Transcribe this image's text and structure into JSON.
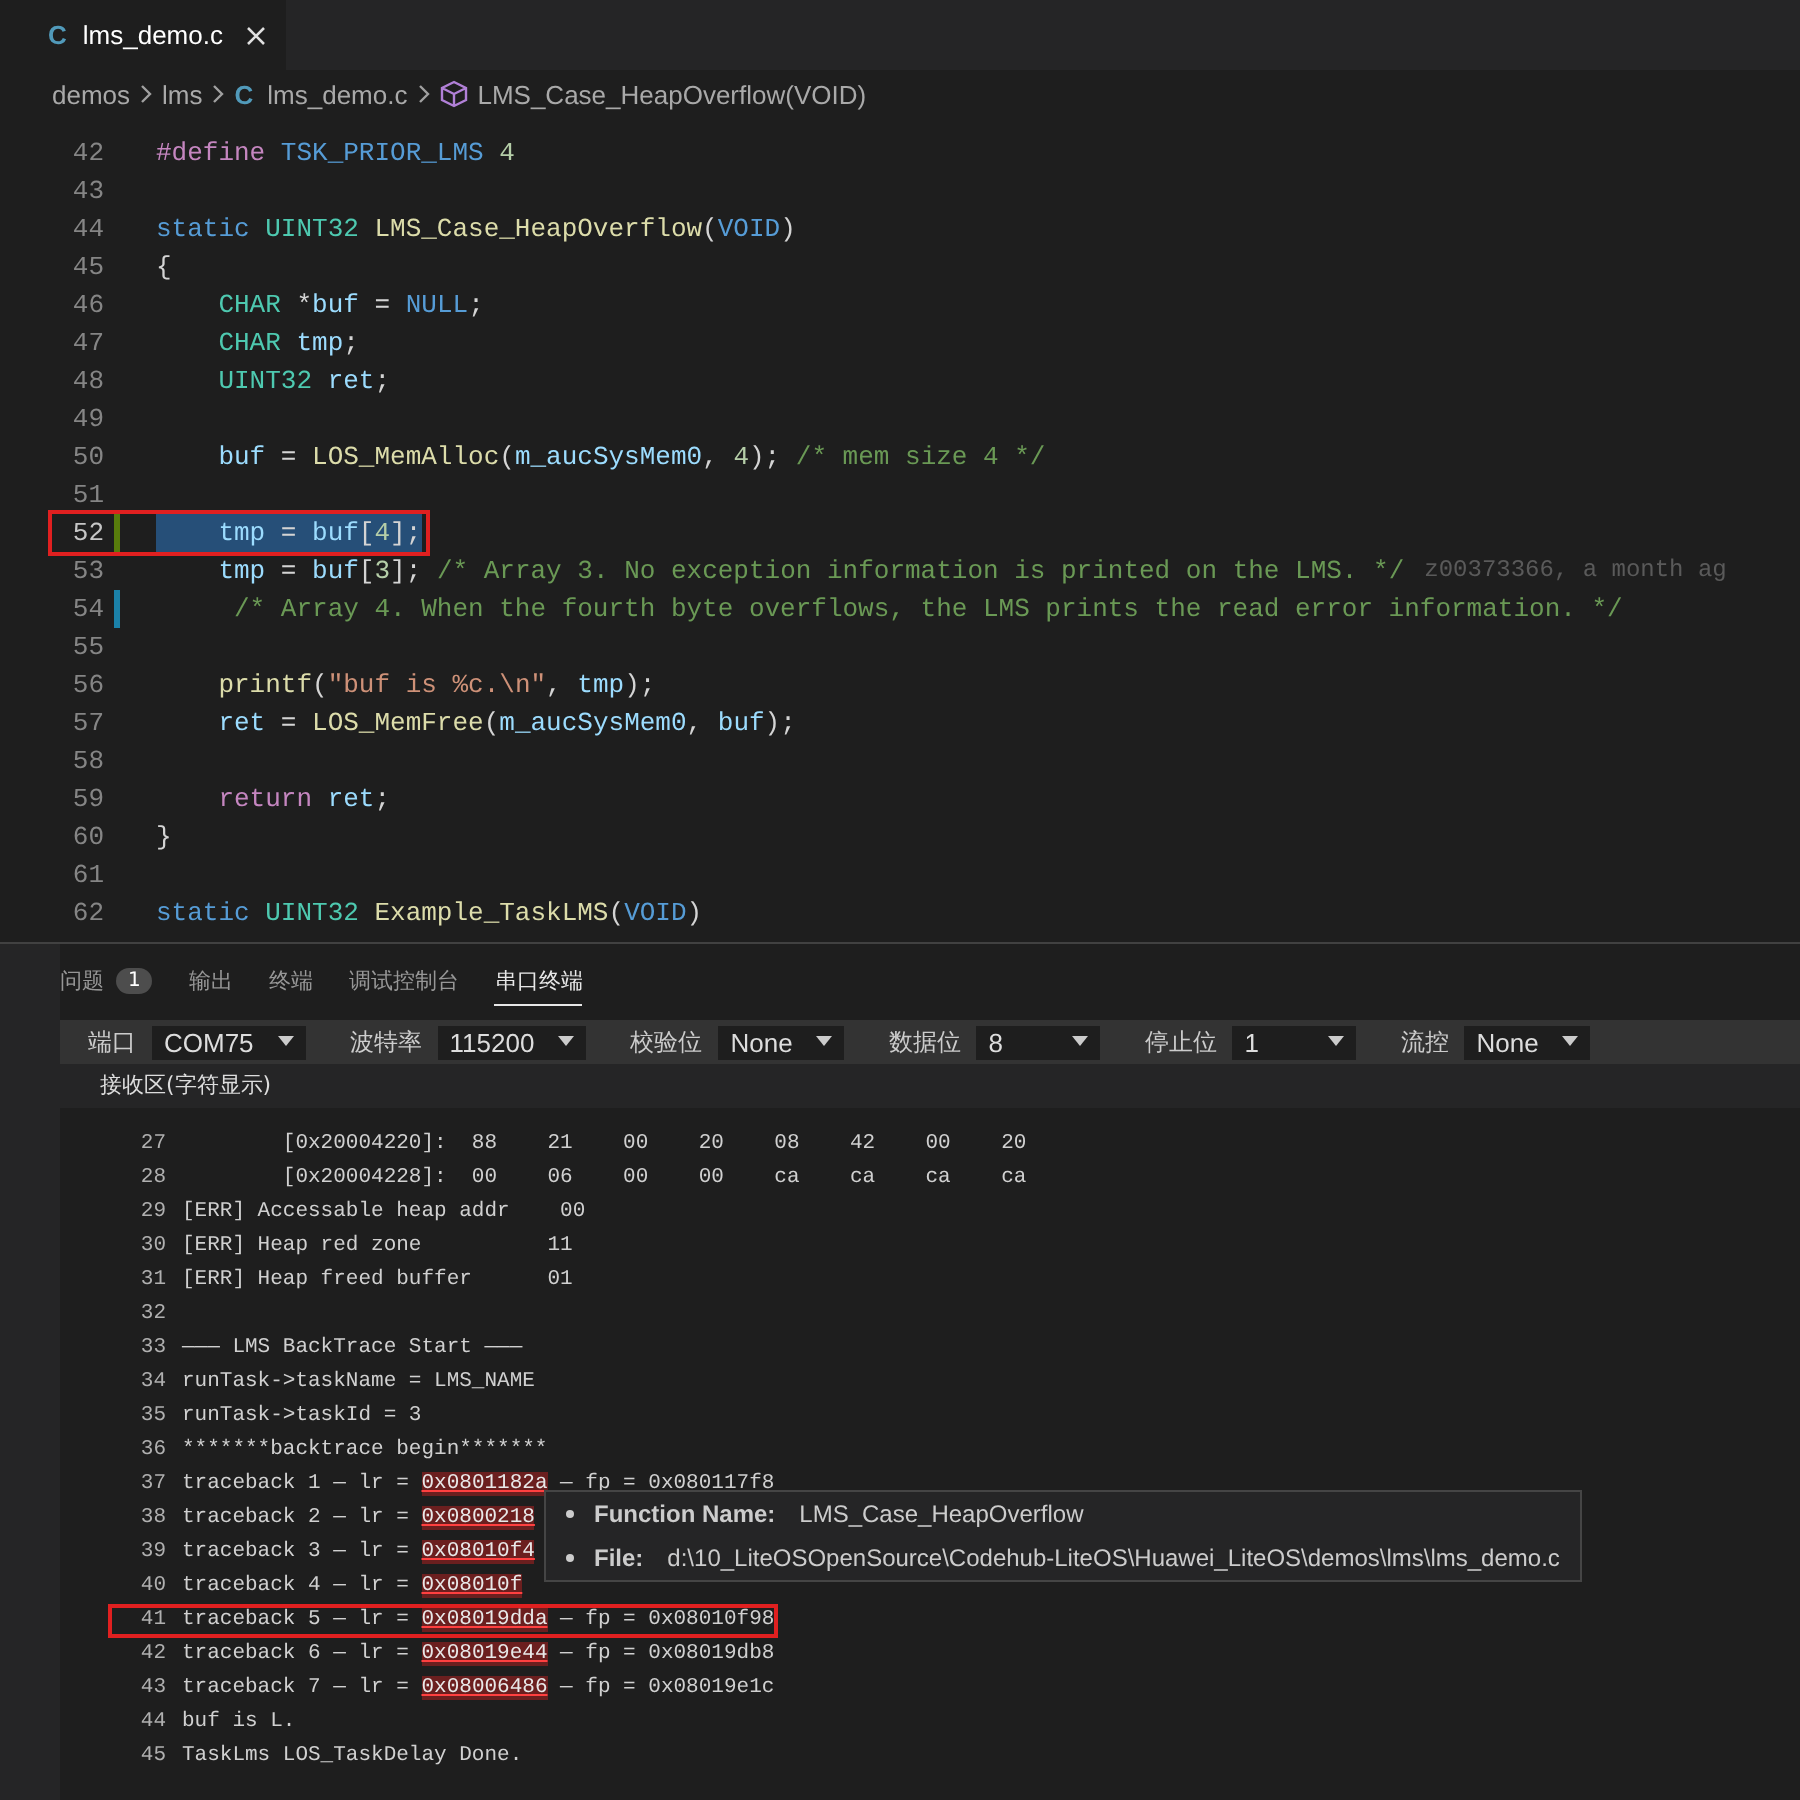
{
  "editor_tabs": [
    {
      "icon": "C",
      "label": "lms_demo.c",
      "selected": true
    }
  ],
  "breadcrumb": [
    {
      "kind": "folder",
      "label": "demos"
    },
    {
      "kind": "folder",
      "label": "lms"
    },
    {
      "kind": "file",
      "icon": "C",
      "label": "lms_demo.c"
    },
    {
      "kind": "symbol",
      "label": "LMS_Case_HeapOverflow(VOID)"
    }
  ],
  "code": {
    "lines": [
      {
        "number": "42",
        "selected": false,
        "added": false,
        "modified": false,
        "segments": [
          {
            "t": "#define ",
            "kind": "macro"
          },
          {
            "t": "TSK_PRIOR_LMS ",
            "kind": "keyword"
          },
          {
            "t": "4",
            "kind": "number"
          }
        ]
      },
      {
        "number": "43",
        "selected": false,
        "added": false,
        "modified": false
      },
      {
        "number": "44",
        "selected": false,
        "added": false,
        "modified": false,
        "segments": [
          {
            "t": "static ",
            "kind": "keyword"
          },
          {
            "t": "UINT32 ",
            "kind": "type"
          },
          {
            "t": "LMS_Case_HeapOverflow",
            "kind": "function"
          },
          {
            "t": "("
          },
          {
            "t": "VOID",
            "kind": "keyword"
          },
          {
            "t": ")"
          }
        ]
      },
      {
        "number": "45",
        "selected": false,
        "added": false,
        "modified": false,
        "segments": [
          {
            "t": "{"
          }
        ]
      },
      {
        "number": "46",
        "selected": false,
        "added": false,
        "modified": false,
        "segments": [
          {
            "t": "    CHAR",
            "kind": "type"
          },
          {
            "t": " *"
          },
          {
            "t": "buf",
            "kind": "variable"
          },
          {
            "t": " = "
          },
          {
            "t": "NULL",
            "kind": "keyword"
          },
          {
            "t": ";"
          }
        ]
      },
      {
        "number": "47",
        "selected": false,
        "added": false,
        "modified": false,
        "segments": [
          {
            "t": "    CHAR ",
            "kind": "type"
          },
          {
            "t": "tmp",
            "kind": "variable"
          },
          {
            "t": ";"
          }
        ]
      },
      {
        "number": "48",
        "selected": false,
        "added": false,
        "modified": false,
        "segments": [
          {
            "t": "    UINT32 ",
            "kind": "type"
          },
          {
            "t": "ret",
            "kind": "variable"
          },
          {
            "t": ";"
          }
        ]
      },
      {
        "number": "49",
        "selected": false,
        "added": false,
        "modified": false
      },
      {
        "number": "50",
        "selected": false,
        "added": false,
        "modified": false,
        "segments": [
          {
            "t": "    buf",
            "kind": "variable"
          },
          {
            "t": " = "
          },
          {
            "t": "LOS_MemAlloc",
            "kind": "function"
          },
          {
            "t": "("
          },
          {
            "t": "m_aucSysMem0",
            "kind": "variable"
          },
          {
            "t": ", "
          },
          {
            "t": "4",
            "kind": "number"
          },
          {
            "t": "); "
          },
          {
            "t": "/* mem size 4 */",
            "kind": "comment"
          }
        ]
      },
      {
        "number": "51",
        "selected": false,
        "added": false,
        "modified": false
      },
      {
        "number": "52",
        "selected": true,
        "annotated": true,
        "added": true,
        "modified": false,
        "segments": [
          {
            "t": "    tmp",
            "kind": "variable"
          },
          {
            "t": " = "
          },
          {
            "t": "buf",
            "kind": "variable"
          },
          {
            "t": "["
          },
          {
            "t": "4",
            "kind": "number"
          },
          {
            "t": "];"
          }
        ]
      },
      {
        "number": "53",
        "selected": false,
        "added": false,
        "modified": false,
        "blame": "z00373366, a month ag",
        "segments": [
          {
            "t": "    tmp",
            "kind": "variable"
          },
          {
            "t": " = "
          },
          {
            "t": "buf",
            "kind": "variable"
          },
          {
            "t": "["
          },
          {
            "t": "3",
            "kind": "number"
          },
          {
            "t": "]; "
          },
          {
            "t": "/* Array 3. No exception information is printed on the LMS. */",
            "kind": "comment"
          }
        ]
      },
      {
        "number": "54",
        "selected": false,
        "added": false,
        "modified": true,
        "segments": [
          {
            "t": "     /* Array 4. When the fourth byte overflows, the LMS prints the read error information. */",
            "kind": "comment"
          }
        ]
      },
      {
        "number": "55",
        "selected": false,
        "added": false,
        "modified": false
      },
      {
        "number": "56",
        "selected": false,
        "added": false,
        "modified": false,
        "segments": [
          {
            "t": "    printf",
            "kind": "function"
          },
          {
            "t": "("
          },
          {
            "t": "\"buf is %c.\\n\"",
            "kind": "string"
          },
          {
            "t": ", "
          },
          {
            "t": "tmp",
            "kind": "variable"
          },
          {
            "t": ");"
          }
        ]
      },
      {
        "number": "57",
        "selected": false,
        "added": false,
        "modified": false,
        "segments": [
          {
            "t": "    ret",
            "kind": "variable"
          },
          {
            "t": " = "
          },
          {
            "t": "LOS_MemFree",
            "kind": "function"
          },
          {
            "t": "("
          },
          {
            "t": "m_aucSysMem0",
            "kind": "variable"
          },
          {
            "t": ", "
          },
          {
            "t": "buf",
            "kind": "variable"
          },
          {
            "t": ");"
          }
        ]
      },
      {
        "number": "58",
        "selected": false,
        "added": false,
        "modified": false
      },
      {
        "number": "59",
        "selected": false,
        "added": false,
        "modified": false,
        "segments": [
          {
            "t": "    return ",
            "kind": "control"
          },
          {
            "t": "ret",
            "kind": "variable"
          },
          {
            "t": ";"
          }
        ]
      },
      {
        "number": "60",
        "selected": false,
        "added": false,
        "modified": false,
        "segments": [
          {
            "t": "}"
          }
        ]
      },
      {
        "number": "61",
        "selected": false,
        "added": false,
        "modified": false
      },
      {
        "number": "62",
        "selected": false,
        "added": false,
        "modified": false,
        "segments": [
          {
            "t": "static ",
            "kind": "keyword"
          },
          {
            "t": "UINT32 ",
            "kind": "type"
          },
          {
            "t": "Example_TaskLMS",
            "kind": "function"
          },
          {
            "t": "("
          },
          {
            "t": "VOID",
            "kind": "keyword"
          },
          {
            "t": ")"
          }
        ]
      }
    ]
  },
  "panel": {
    "tabs": [
      {
        "label": "问题",
        "badge": "1",
        "selected": false
      },
      {
        "label": "输出",
        "selected": false
      },
      {
        "label": "终端",
        "selected": false
      },
      {
        "label": "调试控制台",
        "selected": false
      },
      {
        "label": "串口终端",
        "selected": true
      }
    ],
    "settings": [
      {
        "label": "端口",
        "value": "COM75"
      },
      {
        "label": "波特率",
        "value": "115200"
      },
      {
        "label": "校验位",
        "value": "None"
      },
      {
        "label": "数据位",
        "value": "8"
      },
      {
        "label": "停止位",
        "value": "1"
      },
      {
        "label": "流控",
        "value": "None"
      }
    ],
    "receive_header": "接收区(字符显示)",
    "lines": [
      {
        "number": "27",
        "segments": [
          {
            "t": "        [0x20004220]:  88    21    00    20    08    42    00    20"
          }
        ]
      },
      {
        "number": "28",
        "segments": [
          {
            "t": "        [0x20004228]:  00    06    00    00    ca    ca    ca    ca"
          }
        ]
      },
      {
        "number": "29",
        "segments": [
          {
            "t": "[ERR] Accessable heap addr    00"
          }
        ]
      },
      {
        "number": "30",
        "segments": [
          {
            "t": "[ERR] Heap red zone          11"
          }
        ]
      },
      {
        "number": "31",
        "segments": [
          {
            "t": "[ERR] Heap freed buffer      01"
          }
        ]
      },
      {
        "number": "32"
      },
      {
        "number": "33",
        "segments": [
          {
            "t": "——— LMS BackTrace Start ———"
          }
        ]
      },
      {
        "number": "34",
        "segments": [
          {
            "t": "runTask->taskName = LMS_NAME"
          }
        ]
      },
      {
        "number": "35",
        "segments": [
          {
            "t": "runTask->taskId = 3"
          }
        ]
      },
      {
        "number": "36",
        "segments": [
          {
            "t": "*******backtrace begin*******"
          }
        ]
      },
      {
        "number": "37",
        "segments": [
          {
            "t": "traceback 1 — lr = "
          },
          {
            "t": "0x0801182a",
            "kind": "link"
          },
          {
            "t": " — fp = 0x080117f8"
          }
        ]
      },
      {
        "number": "38",
        "segments": [
          {
            "t": "traceback 2 — lr = "
          },
          {
            "t": "0x0800218",
            "kind": "link"
          }
        ]
      },
      {
        "number": "39",
        "segments": [
          {
            "t": "traceback 3 — lr = "
          },
          {
            "t": "0x08010f4",
            "kind": "link"
          }
        ]
      },
      {
        "number": "40",
        "segments": [
          {
            "t": "traceback 4 — lr = "
          },
          {
            "t": "0x08010f",
            "kind": "link"
          }
        ]
      },
      {
        "number": "41",
        "annotated": true,
        "segments": [
          {
            "t": "traceback 5 — lr = "
          },
          {
            "t": "0x08019dda",
            "kind": "link"
          },
          {
            "t": " — fp = 0x08010f98"
          }
        ]
      },
      {
        "number": "42",
        "segments": [
          {
            "t": "traceback 6 — lr = "
          },
          {
            "t": "0x08019e44",
            "kind": "link"
          },
          {
            "t": " — fp = 0x08019db8"
          }
        ]
      },
      {
        "number": "43",
        "segments": [
          {
            "t": "traceback 7 — lr = "
          },
          {
            "t": "0x08006486",
            "kind": "link"
          },
          {
            "t": " — fp = 0x08019e1c"
          }
        ]
      },
      {
        "number": "44",
        "segments": [
          {
            "t": "buf is L."
          }
        ]
      },
      {
        "number": "45",
        "segments": [
          {
            "t": "TaskLms LOS_TaskDelay Done."
          }
        ]
      }
    ],
    "tooltip": [
      {
        "label": "Function Name:",
        "value": "LMS_Case_HeapOverflow"
      },
      {
        "label": "File:",
        "value": "d:\\10_LiteOSOpenSource\\Codehub-LiteOS\\Huawei_LiteOS\\demos\\lms\\lms_demo.c"
      }
    ]
  }
}
